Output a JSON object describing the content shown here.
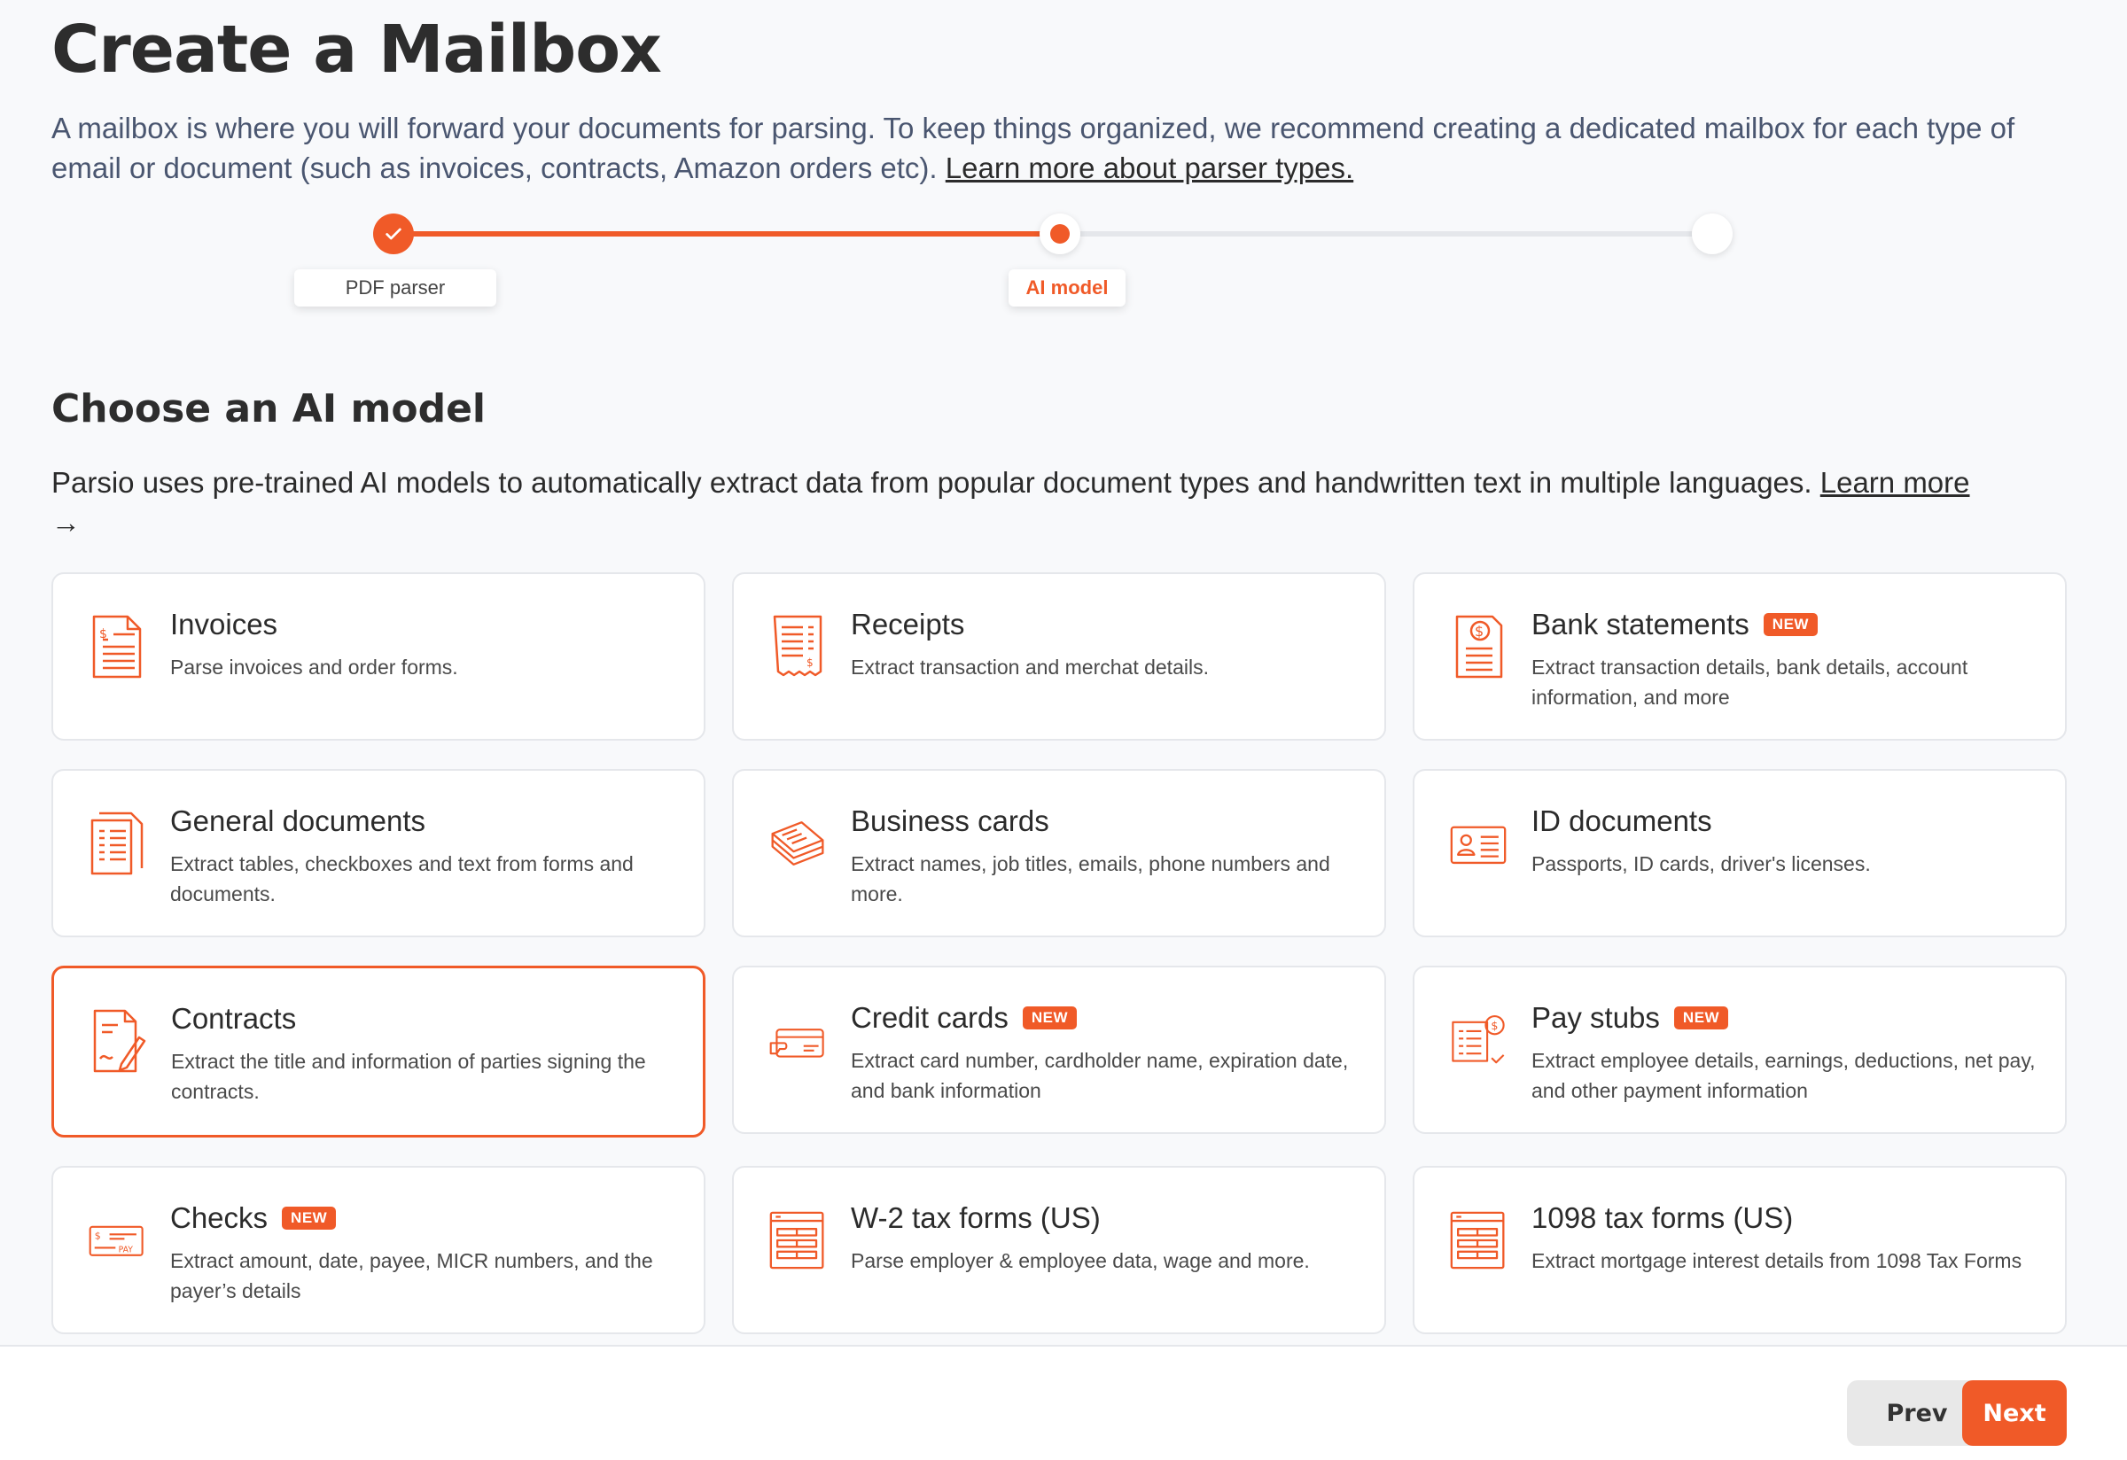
{
  "header": {
    "title": "Create a Mailbox",
    "intro": "A mailbox is where you will forward your documents for parsing. To keep things organized, we recommend creating a dedicated mailbox for each type of email or document (such as invoices, contracts, Amazon orders etc).",
    "intro_link": "Learn more about parser types."
  },
  "stepper": {
    "steps": [
      {
        "label": "PDF parser",
        "state": "done"
      },
      {
        "label": "AI model",
        "state": "current"
      },
      {
        "label": "",
        "state": "todo"
      }
    ]
  },
  "section": {
    "title": "Choose an AI model",
    "intro": "Parsio uses pre-trained AI models to automatically extract data from popular document types and handwritten text in multiple languages.",
    "learn_more": "Learn more",
    "arrow": "→"
  },
  "cards": [
    {
      "title": "Invoices",
      "desc": "Parse invoices and order forms.",
      "badge": "",
      "icon": "invoice-icon"
    },
    {
      "title": "Receipts",
      "desc": "Extract transaction and merchat details.",
      "badge": "",
      "icon": "receipt-icon"
    },
    {
      "title": "Bank statements",
      "desc": "Extract transaction details, bank details, account information, and more",
      "badge": "NEW",
      "icon": "bank-statement-icon"
    },
    {
      "title": "General documents",
      "desc": "Extract tables, checkboxes and text from forms and documents.",
      "badge": "",
      "icon": "general-document-icon"
    },
    {
      "title": "Business cards",
      "desc": "Extract names, job titles, emails, phone numbers and more.",
      "badge": "",
      "icon": "business-cards-icon"
    },
    {
      "title": "ID documents",
      "desc": "Passports, ID cards, driver's licenses.",
      "badge": "",
      "icon": "id-card-icon"
    },
    {
      "title": "Contracts",
      "desc": "Extract the title and information of parties signing the contracts.",
      "badge": "",
      "icon": "contract-icon",
      "selected": true
    },
    {
      "title": "Credit cards",
      "desc": "Extract card number, cardholder name, expiration date, and bank information",
      "badge": "NEW",
      "icon": "credit-card-icon"
    },
    {
      "title": "Pay stubs",
      "desc": "Extract employee details, earnings, deductions, net pay, and other payment information",
      "badge": "NEW",
      "icon": "pay-stub-icon"
    },
    {
      "title": "Checks",
      "desc": "Extract amount, date, payee, MICR numbers, and the payer’s details",
      "badge": "NEW",
      "icon": "check-icon"
    },
    {
      "title": "W-2 tax forms (US)",
      "desc": "Parse employer & employee data, wage and more.",
      "badge": "",
      "icon": "tax-form-icon"
    },
    {
      "title": "1098 tax forms (US)",
      "desc": "Extract mortgage interest details from 1098 Tax Forms",
      "badge": "",
      "icon": "tax-form-icon"
    }
  ],
  "footer": {
    "prev_label": "Prev",
    "next_label": "Next"
  },
  "colors": {
    "accent": "#f05a28",
    "border": "#e5e7eb",
    "background": "#f8f9fb"
  }
}
